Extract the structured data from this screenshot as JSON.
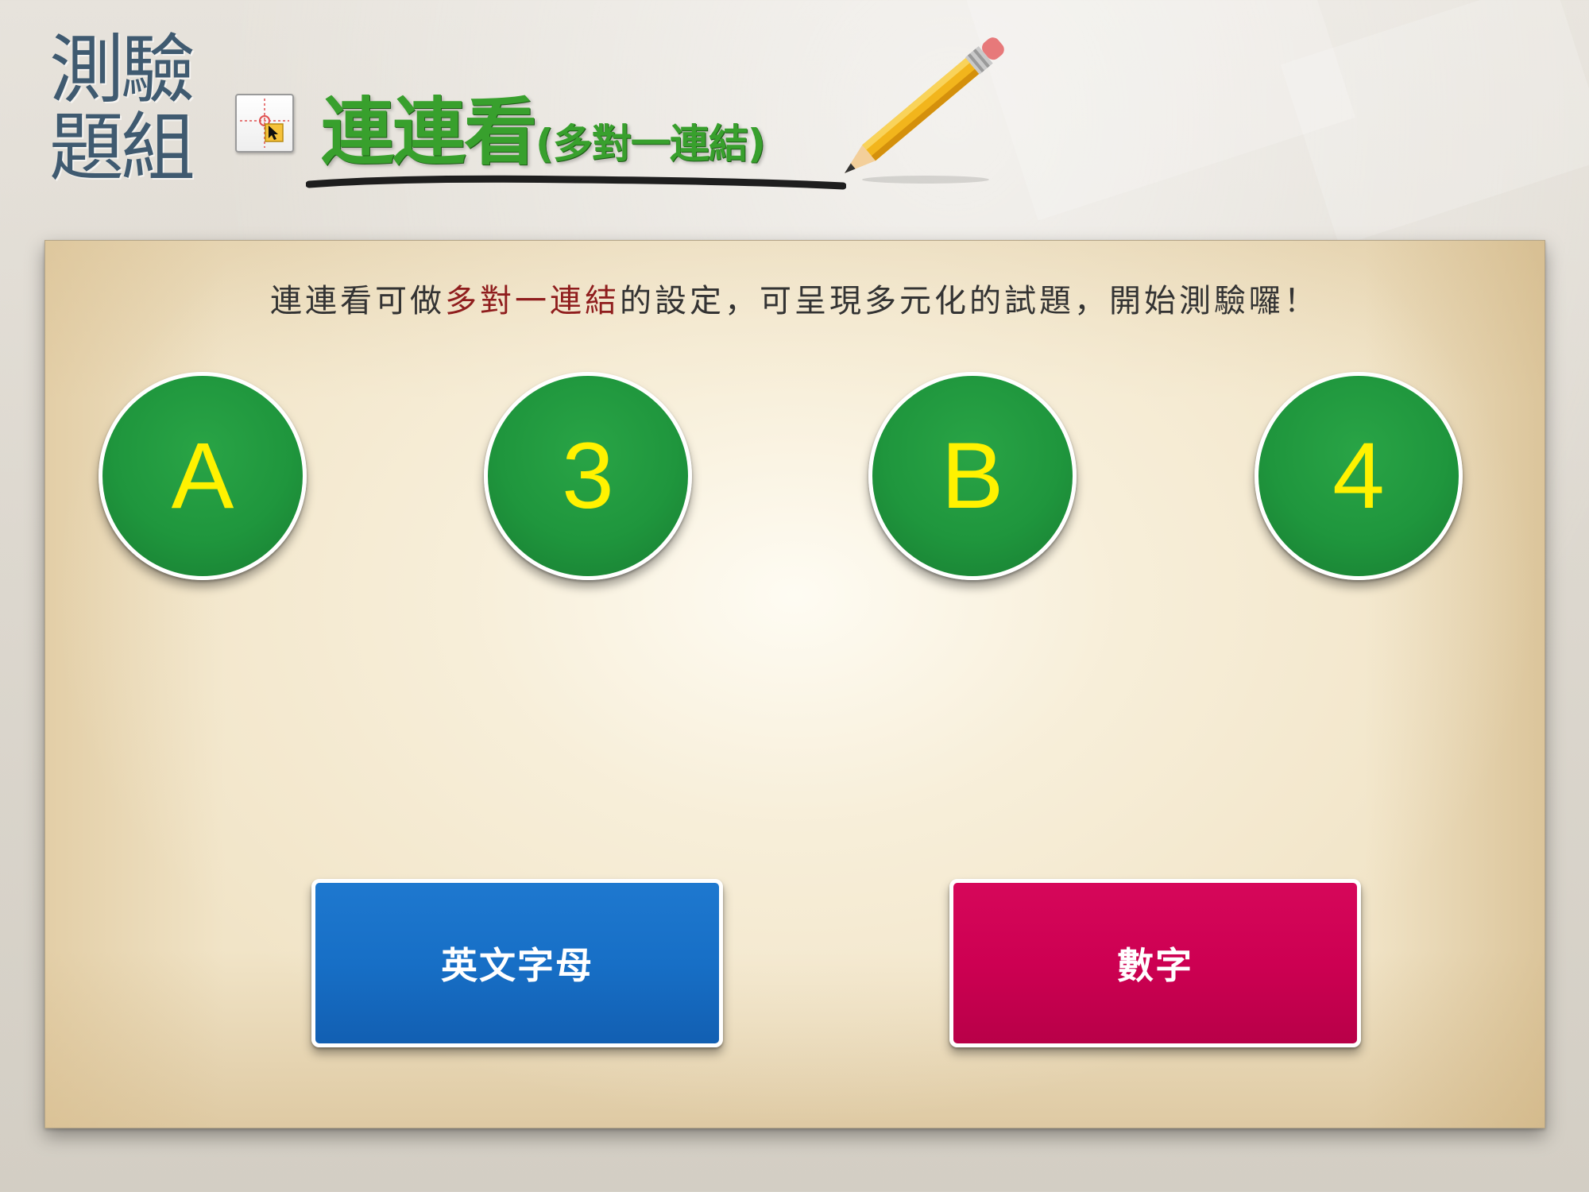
{
  "header": {
    "side_title_line1": "測驗",
    "side_title_line2": "題組",
    "title_main": "連連看",
    "title_sub": "(多對一連結)",
    "cursor_icon": "crosshair-cursor-icon",
    "pencil_icon": "pencil-icon"
  },
  "instruction": {
    "part1": "連連看可做",
    "highlight": "多對一連結",
    "part2": "的設定，可呈現多元化的試題，開始測驗囉！"
  },
  "items": [
    {
      "label": "A"
    },
    {
      "label": "3"
    },
    {
      "label": "B"
    },
    {
      "label": "4"
    }
  ],
  "targets": [
    {
      "label": "英文字母",
      "color": "#176fc6"
    },
    {
      "label": "數字",
      "color": "#cd0052"
    }
  ],
  "colors": {
    "title_green": "#38a02d",
    "circle_green": "#1f963d",
    "circle_text": "#fff200",
    "side_title": "#3f5a70",
    "highlight": "#8f1d1d"
  }
}
